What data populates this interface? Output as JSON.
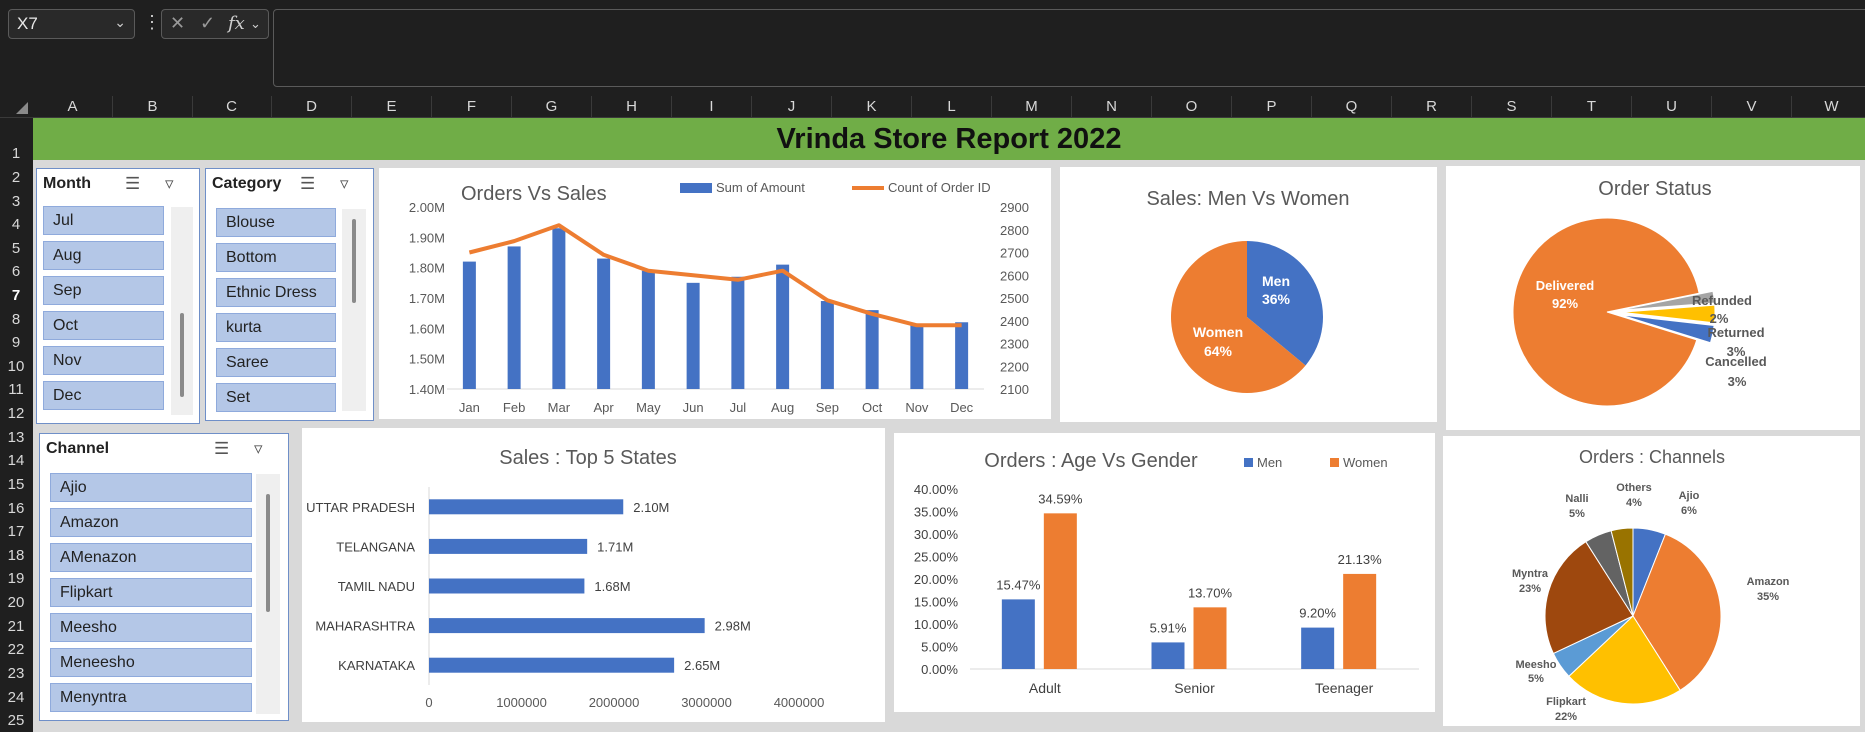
{
  "formula_bar": {
    "name_box": "X7",
    "fx_label": "fx",
    "formula": ""
  },
  "columns": [
    "A",
    "B",
    "C",
    "D",
    "E",
    "F",
    "G",
    "H",
    "I",
    "J",
    "K",
    "L",
    "M",
    "N",
    "O",
    "P",
    "Q",
    "R",
    "S",
    "T",
    "U",
    "V",
    "W"
  ],
  "rows": [
    "1",
    "2",
    "3",
    "4",
    "5",
    "6",
    "7",
    "8",
    "9",
    "10",
    "11",
    "12",
    "13",
    "14",
    "15",
    "16",
    "17",
    "18",
    "19",
    "20",
    "21",
    "22",
    "23",
    "24",
    "25"
  ],
  "selected_row": "7",
  "report_title": "Vrinda Store Report 2022",
  "slicers": {
    "month": {
      "title": "Month",
      "items": [
        "Jul",
        "Aug",
        "Sep",
        "Oct",
        "Nov",
        "Dec"
      ]
    },
    "category": {
      "title": "Category",
      "items": [
        "Blouse",
        "Bottom",
        "Ethnic Dress",
        "kurta",
        "Saree",
        "Set"
      ]
    },
    "channel": {
      "title": "Channel",
      "items": [
        "Ajio",
        "Amazon",
        "AMenazon",
        "Flipkart",
        "Meesho",
        "Meneesho",
        "Menyntra"
      ]
    }
  },
  "chart_data": [
    {
      "type": "bar",
      "title": "Orders Vs Sales",
      "categories": [
        "Jan",
        "Feb",
        "Mar",
        "Apr",
        "May",
        "Jun",
        "Jul",
        "Aug",
        "Sep",
        "Oct",
        "Nov",
        "Dec"
      ],
      "series": [
        {
          "name": "Sum of Amount",
          "color": "#4472c4",
          "axis": "left",
          "values": [
            1.82,
            1.87,
            1.93,
            1.83,
            1.79,
            1.75,
            1.77,
            1.81,
            1.69,
            1.66,
            1.61,
            1.62
          ]
        },
        {
          "name": "Count of Order ID",
          "color": "#ed7d31",
          "axis": "right",
          "type": "line",
          "values": [
            2700,
            2750,
            2820,
            2690,
            2620,
            2600,
            2580,
            2620,
            2490,
            2430,
            2380,
            2380
          ]
        }
      ],
      "y_left": {
        "ticks": [
          "1.40M",
          "1.50M",
          "1.60M",
          "1.70M",
          "1.80M",
          "1.90M",
          "2.00M"
        ],
        "range": [
          1.4,
          2.0
        ]
      },
      "y_right": {
        "ticks": [
          "2100",
          "2200",
          "2300",
          "2400",
          "2500",
          "2600",
          "2700",
          "2800",
          "2900"
        ],
        "range": [
          2100,
          2900
        ]
      },
      "legend": "top"
    },
    {
      "type": "pie",
      "title": "Sales: Men Vs Women",
      "slices": [
        {
          "label": "Men",
          "percent_label": "36%",
          "value": 36,
          "color": "#4472c4"
        },
        {
          "label": "Women",
          "percent_label": "64%",
          "value": 64,
          "color": "#ed7d31"
        }
      ]
    },
    {
      "type": "pie",
      "title": "Order Status",
      "slices": [
        {
          "label": "Delivered",
          "percent_label": "92%",
          "value": 92,
          "color": "#ed7d31"
        },
        {
          "label": "Refunded",
          "percent_label": "2%",
          "value": 2,
          "color": "#a5a5a5"
        },
        {
          "label": "Returned",
          "percent_label": "3%",
          "value": 3,
          "color": "#ffc000"
        },
        {
          "label": "Cancelled",
          "percent_label": "3%",
          "value": 3,
          "color": "#4472c4"
        }
      ]
    },
    {
      "type": "bar",
      "orientation": "horizontal",
      "title": "Sales : Top 5 States",
      "categories": [
        "UTTAR PRADESH",
        "TELANGANA",
        "TAMIL NADU",
        "MAHARASHTRA",
        "KARNATAKA"
      ],
      "values": [
        2100000,
        1710000,
        1680000,
        2980000,
        2650000
      ],
      "data_labels": [
        "2.10M",
        "1.71M",
        "1.68M",
        "2.98M",
        "2.65M"
      ],
      "x_ticks": [
        "0",
        "1000000",
        "2000000",
        "3000000",
        "4000000"
      ],
      "xlim": [
        0,
        4000000
      ],
      "color": "#4472c4"
    },
    {
      "type": "bar",
      "title": "Orders : Age Vs Gender",
      "categories": [
        "Adult",
        "Senior",
        "Teenager"
      ],
      "series": [
        {
          "name": "Men",
          "color": "#4472c4",
          "values": [
            15.47,
            5.91,
            9.2
          ],
          "labels": [
            "15.47%",
            "5.91%",
            "9.20%"
          ]
        },
        {
          "name": "Women",
          "color": "#ed7d31",
          "values": [
            34.59,
            13.7,
            21.13
          ],
          "labels": [
            "34.59%",
            "13.70%",
            "21.13%"
          ]
        }
      ],
      "y_ticks": [
        "0.00%",
        "5.00%",
        "10.00%",
        "15.00%",
        "20.00%",
        "25.00%",
        "30.00%",
        "35.00%",
        "40.00%"
      ],
      "ylim": [
        0,
        40
      ],
      "legend": "top-right"
    },
    {
      "type": "pie",
      "title": "Orders : Channels",
      "slices": [
        {
          "label": "Ajio",
          "percent_label": "6%",
          "value": 6,
          "color": "#4472c4"
        },
        {
          "label": "Amazon",
          "percent_label": "35%",
          "value": 35,
          "color": "#ed7d31"
        },
        {
          "label": "Flipkart",
          "percent_label": "22%",
          "value": 22,
          "color": "#ffc000"
        },
        {
          "label": "Meesho",
          "percent_label": "5%",
          "value": 5,
          "color": "#5b9bd5"
        },
        {
          "label": "Myntra",
          "percent_label": "23%",
          "value": 23,
          "color": "#9e480e"
        },
        {
          "label": "Nalli",
          "percent_label": "5%",
          "value": 5,
          "color": "#636363"
        },
        {
          "label": "Others",
          "percent_label": "4%",
          "value": 4,
          "color": "#997300"
        }
      ]
    }
  ]
}
